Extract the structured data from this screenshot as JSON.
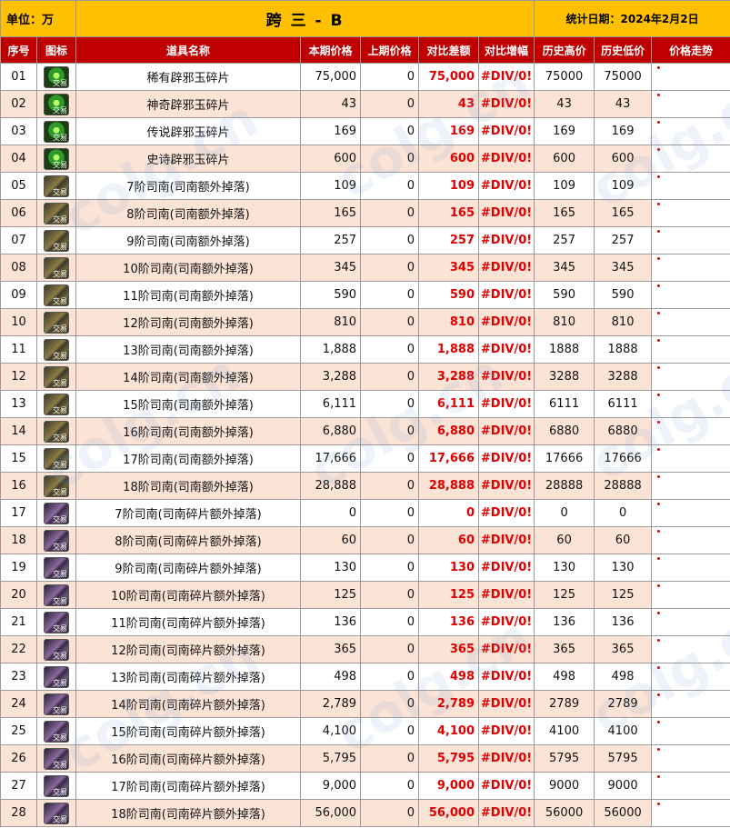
{
  "header": {
    "unit": "单位：万",
    "title": "跨 三 - B",
    "date": "统计日期：2024年2月2日"
  },
  "columns": [
    "序号",
    "图标",
    "道具名称",
    "本期价格",
    "上期价格",
    "对比差额",
    "对比增幅",
    "历史高价",
    "历史低价",
    "价格走势"
  ],
  "watermark": "colg.cn",
  "rows": [
    {
      "no": "01",
      "icon": "green",
      "tag": "交易",
      "name": "稀有辟邪玉碎片",
      "cur": "75,000",
      "prev": "0",
      "diff": "75,000",
      "pct": "#DIV/0!",
      "high": "75000",
      "low": "75000"
    },
    {
      "no": "02",
      "icon": "green",
      "tag": "交易",
      "name": "神奇辟邪玉碎片",
      "cur": "43",
      "prev": "0",
      "diff": "43",
      "pct": "#DIV/0!",
      "high": "43",
      "low": "43"
    },
    {
      "no": "03",
      "icon": "green",
      "tag": "交易",
      "name": "传说辟邪玉碎片",
      "cur": "169",
      "prev": "0",
      "diff": "169",
      "pct": "#DIV/0!",
      "high": "169",
      "low": "169"
    },
    {
      "no": "04",
      "icon": "green",
      "tag": "交易",
      "name": "史诗辟邪玉碎片",
      "cur": "600",
      "prev": "0",
      "diff": "600",
      "pct": "#DIV/0!",
      "high": "600",
      "low": "600"
    },
    {
      "no": "05",
      "icon": "gold",
      "tag": "交易",
      "name": "7阶司南(司南额外掉落)",
      "cur": "109",
      "prev": "0",
      "diff": "109",
      "pct": "#DIV/0!",
      "high": "109",
      "low": "109"
    },
    {
      "no": "06",
      "icon": "gold",
      "tag": "交易",
      "name": "8阶司南(司南额外掉落)",
      "cur": "165",
      "prev": "0",
      "diff": "165",
      "pct": "#DIV/0!",
      "high": "165",
      "low": "165"
    },
    {
      "no": "07",
      "icon": "gold",
      "tag": "交易",
      "name": "9阶司南(司南额外掉落)",
      "cur": "257",
      "prev": "0",
      "diff": "257",
      "pct": "#DIV/0!",
      "high": "257",
      "low": "257"
    },
    {
      "no": "08",
      "icon": "gold",
      "tag": "交易",
      "name": "10阶司南(司南额外掉落)",
      "cur": "345",
      "prev": "0",
      "diff": "345",
      "pct": "#DIV/0!",
      "high": "345",
      "low": "345"
    },
    {
      "no": "09",
      "icon": "gold",
      "tag": "交易",
      "name": "11阶司南(司南额外掉落)",
      "cur": "590",
      "prev": "0",
      "diff": "590",
      "pct": "#DIV/0!",
      "high": "590",
      "low": "590"
    },
    {
      "no": "10",
      "icon": "gold",
      "tag": "交易",
      "name": "12阶司南(司南额外掉落)",
      "cur": "810",
      "prev": "0",
      "diff": "810",
      "pct": "#DIV/0!",
      "high": "810",
      "low": "810"
    },
    {
      "no": "11",
      "icon": "gold",
      "tag": "交易",
      "name": "13阶司南(司南额外掉落)",
      "cur": "1,888",
      "prev": "0",
      "diff": "1,888",
      "pct": "#DIV/0!",
      "high": "1888",
      "low": "1888"
    },
    {
      "no": "12",
      "icon": "gold",
      "tag": "交易",
      "name": "14阶司南(司南额外掉落)",
      "cur": "3,288",
      "prev": "0",
      "diff": "3,288",
      "pct": "#DIV/0!",
      "high": "3288",
      "low": "3288"
    },
    {
      "no": "13",
      "icon": "gold",
      "tag": "交易",
      "name": "15阶司南(司南额外掉落)",
      "cur": "6,111",
      "prev": "0",
      "diff": "6,111",
      "pct": "#DIV/0!",
      "high": "6111",
      "low": "6111"
    },
    {
      "no": "14",
      "icon": "gold",
      "tag": "交易",
      "name": "16阶司南(司南额外掉落)",
      "cur": "6,880",
      "prev": "0",
      "diff": "6,880",
      "pct": "#DIV/0!",
      "high": "6880",
      "low": "6880"
    },
    {
      "no": "15",
      "icon": "gold",
      "tag": "交易",
      "name": "17阶司南(司南额外掉落)",
      "cur": "17,666",
      "prev": "0",
      "diff": "17,666",
      "pct": "#DIV/0!",
      "high": "17666",
      "low": "17666"
    },
    {
      "no": "16",
      "icon": "gold",
      "tag": "交易",
      "name": "18阶司南(司南额外掉落)",
      "cur": "28,888",
      "prev": "0",
      "diff": "28,888",
      "pct": "#DIV/0!",
      "high": "28888",
      "low": "28888"
    },
    {
      "no": "17",
      "icon": "purple",
      "tag": "交易",
      "name": "7阶司南(司南碎片额外掉落)",
      "cur": "0",
      "prev": "0",
      "diff": "0",
      "pct": "#DIV/0!",
      "high": "0",
      "low": "0"
    },
    {
      "no": "18",
      "icon": "purple",
      "tag": "交易",
      "name": "8阶司南(司南碎片额外掉落)",
      "cur": "60",
      "prev": "0",
      "diff": "60",
      "pct": "#DIV/0!",
      "high": "60",
      "low": "60"
    },
    {
      "no": "19",
      "icon": "purple",
      "tag": "交易",
      "name": "9阶司南(司南碎片额外掉落)",
      "cur": "130",
      "prev": "0",
      "diff": "130",
      "pct": "#DIV/0!",
      "high": "130",
      "low": "130"
    },
    {
      "no": "20",
      "icon": "purple",
      "tag": "交易",
      "name": "10阶司南(司南碎片额外掉落)",
      "cur": "125",
      "prev": "0",
      "diff": "125",
      "pct": "#DIV/0!",
      "high": "125",
      "low": "125"
    },
    {
      "no": "21",
      "icon": "purple",
      "tag": "交易",
      "name": "11阶司南(司南碎片额外掉落)",
      "cur": "136",
      "prev": "0",
      "diff": "136",
      "pct": "#DIV/0!",
      "high": "136",
      "low": "136"
    },
    {
      "no": "22",
      "icon": "purple",
      "tag": "交易",
      "name": "12阶司南(司南碎片额外掉落)",
      "cur": "365",
      "prev": "0",
      "diff": "365",
      "pct": "#DIV/0!",
      "high": "365",
      "low": "365"
    },
    {
      "no": "23",
      "icon": "purple",
      "tag": "交易",
      "name": "13阶司南(司南碎片额外掉落)",
      "cur": "498",
      "prev": "0",
      "diff": "498",
      "pct": "#DIV/0!",
      "high": "498",
      "low": "498"
    },
    {
      "no": "24",
      "icon": "purple",
      "tag": "交易",
      "name": "14阶司南(司南碎片额外掉落)",
      "cur": "2,789",
      "prev": "0",
      "diff": "2,789",
      "pct": "#DIV/0!",
      "high": "2789",
      "low": "2789"
    },
    {
      "no": "25",
      "icon": "purple",
      "tag": "交易",
      "name": "15阶司南(司南碎片额外掉落)",
      "cur": "4,100",
      "prev": "0",
      "diff": "4,100",
      "pct": "#DIV/0!",
      "high": "4100",
      "low": "4100"
    },
    {
      "no": "26",
      "icon": "purple",
      "tag": "交易",
      "name": "16阶司南(司南碎片额外掉落)",
      "cur": "5,795",
      "prev": "0",
      "diff": "5,795",
      "pct": "#DIV/0!",
      "high": "5795",
      "low": "5795"
    },
    {
      "no": "27",
      "icon": "purple",
      "tag": "交易",
      "name": "17阶司南(司南碎片额外掉落)",
      "cur": "9,000",
      "prev": "0",
      "diff": "9,000",
      "pct": "#DIV/0!",
      "high": "9000",
      "low": "9000"
    },
    {
      "no": "28",
      "icon": "purple",
      "tag": "交易",
      "name": "18阶司南(司南碎片额外掉落)",
      "cur": "56,000",
      "prev": "0",
      "diff": "56,000",
      "pct": "#DIV/0!",
      "high": "56000",
      "low": "56000"
    }
  ],
  "colors": {
    "header_bg": "#ffc000",
    "column_header_bg": "#c00000",
    "alt_row_bg": "#fbe3d6",
    "highlight_text": "#e00000"
  }
}
